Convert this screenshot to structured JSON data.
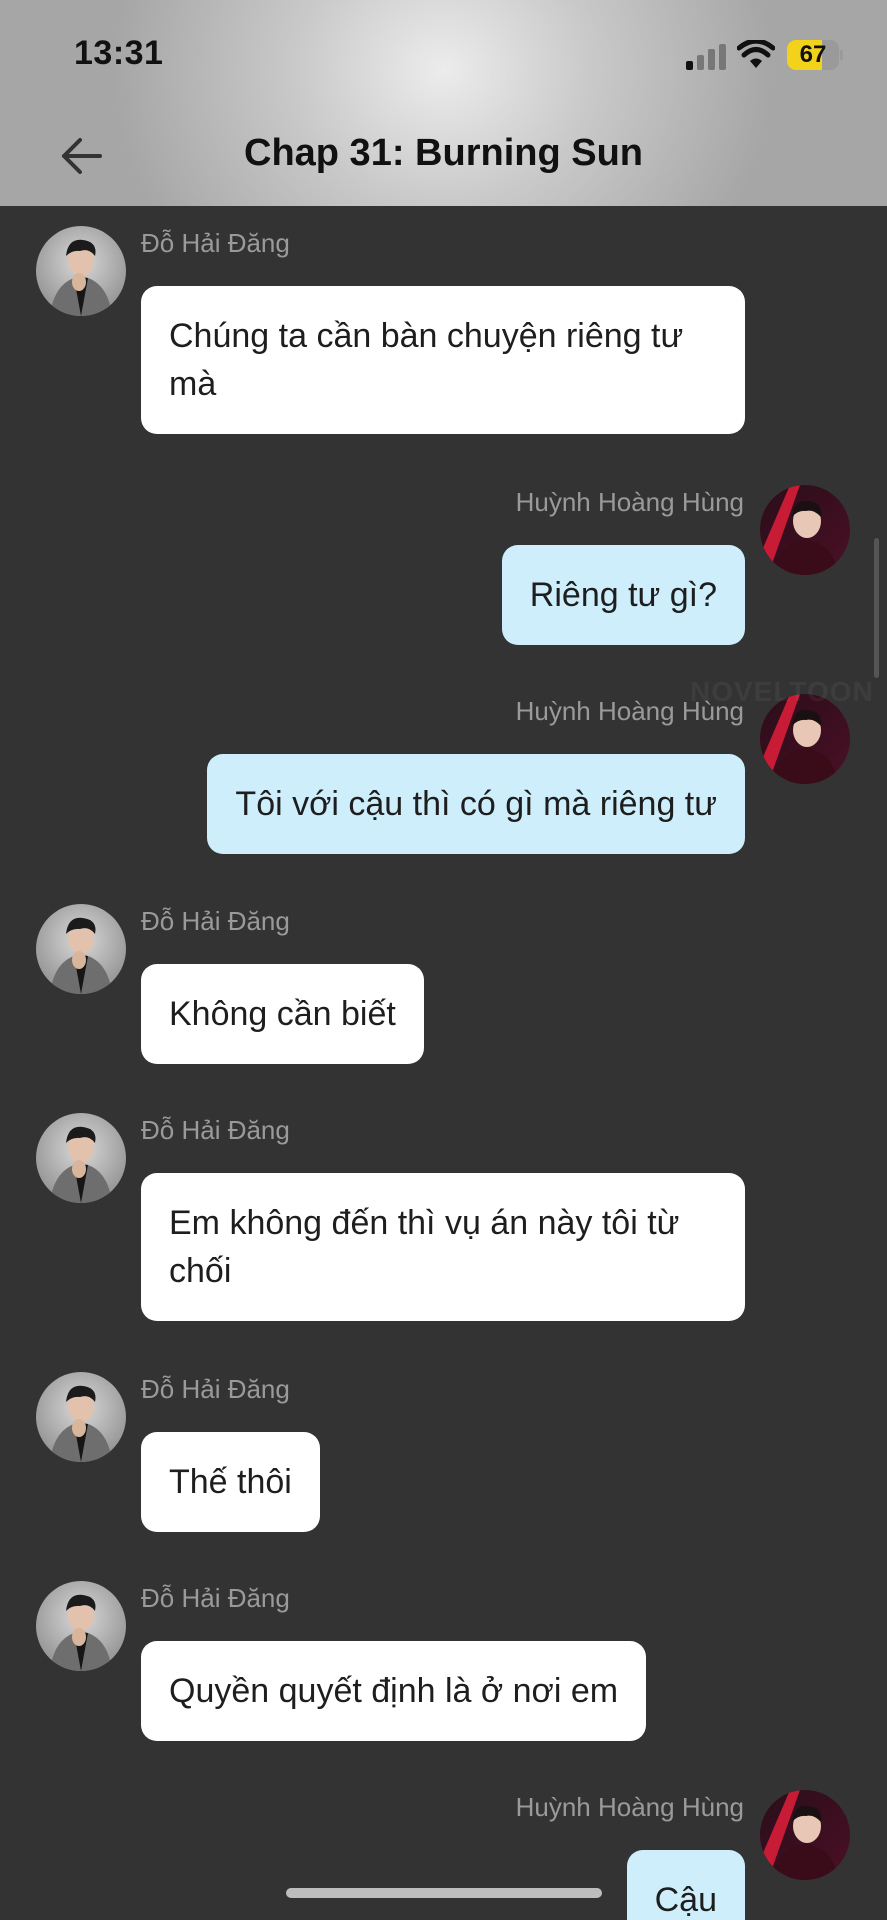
{
  "status_bar": {
    "time": "13:31",
    "battery_level": "67",
    "signal_icon": "cellular-signal-icon",
    "wifi_icon": "wifi-icon",
    "battery_icon": "battery-icon"
  },
  "header": {
    "title": "Chap 31: Burning Sun",
    "back_icon": "arrow-left-icon"
  },
  "watermark": "NOVELTOON",
  "colors": {
    "background": "#333333",
    "incoming_bubble": "#ffffff",
    "outgoing_bubble": "#cdeefa",
    "sender_name": "#9a9a9a",
    "battery_fill": "#f2d21a"
  },
  "messages": [
    {
      "side": "left",
      "sender": "Đỗ Hải Đăng",
      "text": "Chúng ta cần bàn chuyện riêng tư mà"
    },
    {
      "side": "right",
      "sender": "Huỳnh Hoàng Hùng",
      "text": "Riêng tư gì?"
    },
    {
      "side": "right",
      "sender": "Huỳnh Hoàng Hùng",
      "text": "Tôi với cậu thì có gì mà riêng tư"
    },
    {
      "side": "left",
      "sender": "Đỗ Hải Đăng",
      "text": "Không cần biết"
    },
    {
      "side": "left",
      "sender": "Đỗ Hải Đăng",
      "text": "Em không đến thì vụ án này tôi từ chối"
    },
    {
      "side": "left",
      "sender": "Đỗ Hải Đăng",
      "text": "Thế thôi"
    },
    {
      "side": "left",
      "sender": "Đỗ Hải Đăng",
      "text": "Quyền quyết định là ở nơi em"
    },
    {
      "side": "right",
      "sender": "Huỳnh Hoàng Hùng",
      "text": "Cậu"
    }
  ]
}
